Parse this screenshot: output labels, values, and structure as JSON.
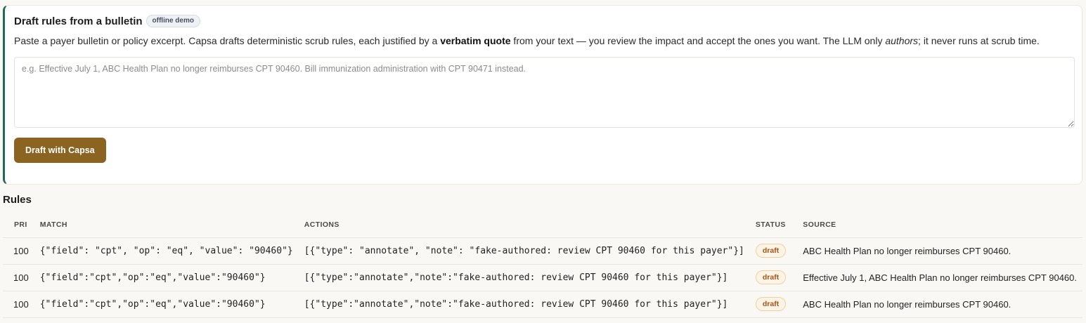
{
  "draft": {
    "title": "Draft rules from a bulletin",
    "badge": "offline demo",
    "desc_part1": "Paste a payer bulletin or policy excerpt. Capsa drafts deterministic scrub rules, each justified by a ",
    "desc_bold": "verbatim quote",
    "desc_part2": " from your text — you review the impact and accept the ones you want. The LLM only ",
    "desc_italic": "authors",
    "desc_part3": "; it never runs at scrub time.",
    "placeholder": "e.g. Effective July 1, ABC Health Plan no longer reimburses CPT 90460. Bill immunization administration with CPT 90471 instead.",
    "button_label": "Draft with Capsa"
  },
  "rules": {
    "title": "Rules",
    "columns": {
      "pri": "PRI",
      "match": "MATCH",
      "actions": "ACTIONS",
      "status": "STATUS",
      "source": "SOURCE"
    },
    "rows": [
      {
        "pri": "100",
        "match": "{\"field\": \"cpt\", \"op\": \"eq\", \"value\": \"90460\"}",
        "actions": "[{\"type\": \"annotate\", \"note\": \"fake-authored: review CPT 90460 for this payer\"}]",
        "status": "draft",
        "source": "ABC Health Plan no longer reimburses CPT 90460."
      },
      {
        "pri": "100",
        "match": "{\"field\":\"cpt\",\"op\":\"eq\",\"value\":\"90460\"}",
        "actions": "[{\"type\":\"annotate\",\"note\":\"fake-authored: review CPT 90460 for this payer\"}]",
        "status": "draft",
        "source": "Effective July 1, ABC Health Plan no longer reimburses CPT 90460."
      },
      {
        "pri": "100",
        "match": "{\"field\":\"cpt\",\"op\":\"eq\",\"value\":\"90460\"}",
        "actions": "[{\"type\":\"annotate\",\"note\":\"fake-authored: review CPT 90460 for this payer\"}]",
        "status": "draft",
        "source": "ABC Health Plan no longer reimburses CPT 90460."
      }
    ]
  },
  "colors": {
    "accent_border": "#1f6b52",
    "button_bg": "#8c6422",
    "status_draft_text": "#a4541a",
    "status_draft_bg": "#fdf4e6"
  }
}
